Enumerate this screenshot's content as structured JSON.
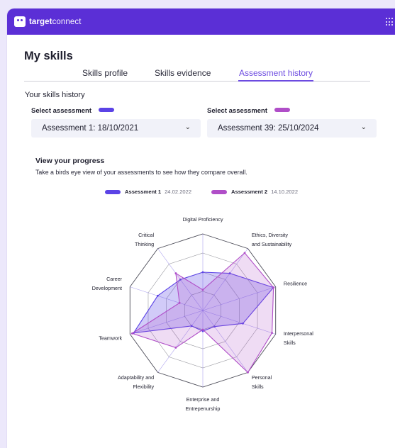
{
  "app": {
    "brand_bold": "target",
    "brand_light": "connect"
  },
  "page": {
    "title": "My skills"
  },
  "tabs": [
    {
      "label": "Skills profile"
    },
    {
      "label": "Skills evidence"
    },
    {
      "label": "Assessment history"
    }
  ],
  "history": {
    "heading": "Your skills history",
    "select1": {
      "label": "Select assessment",
      "value": "Assessment 1: 18/10/2021",
      "color": "#5b43e6"
    },
    "select2": {
      "label": "Select assessment",
      "value": "Assessment 39: 25/10/2024",
      "color": "#b04ec8"
    }
  },
  "progress": {
    "heading": "View your progress",
    "subtitle": "Take a birds eye view of your assessments to see how they compare overall."
  },
  "legend": [
    {
      "name": "Assessment 1",
      "date": "24.02.2022",
      "color": "#5b43e6"
    },
    {
      "name": "Assessment 2",
      "date": "14.10.2022",
      "color": "#b04ec8"
    }
  ],
  "chart_data": {
    "type": "radar",
    "axes": [
      [
        "Digital Proficiency"
      ],
      [
        "Ethics, Diversity",
        "and Sustainability"
      ],
      [
        "Resilience"
      ],
      [
        "Interpersonal",
        "Skills"
      ],
      [
        "Personal",
        "Skills"
      ],
      [
        "Enterprise and",
        "Entrepenurship"
      ],
      [
        "Adaptability and",
        "Flexibility"
      ],
      [
        "Teamwork"
      ],
      [
        "Career",
        "Development"
      ],
      [
        "Critical",
        "Thinking"
      ]
    ],
    "rings": 4,
    "series": [
      {
        "name": "Assessment 1",
        "color": "#5b43e6",
        "values": [
          0.5,
          0.6,
          0.97,
          0.55,
          0.26,
          0.27,
          0.25,
          0.95,
          0.62,
          0.5
        ]
      },
      {
        "name": "Assessment 2",
        "color": "#b04ec8",
        "values": [
          0.27,
          0.93,
          0.97,
          0.95,
          1.0,
          0.25,
          0.6,
          0.97,
          0.32,
          0.6
        ]
      }
    ]
  },
  "icons": {
    "logo": "target-connect-logo-icon",
    "apps": "grid-menu-icon",
    "chevron": "chevron-down-icon"
  }
}
